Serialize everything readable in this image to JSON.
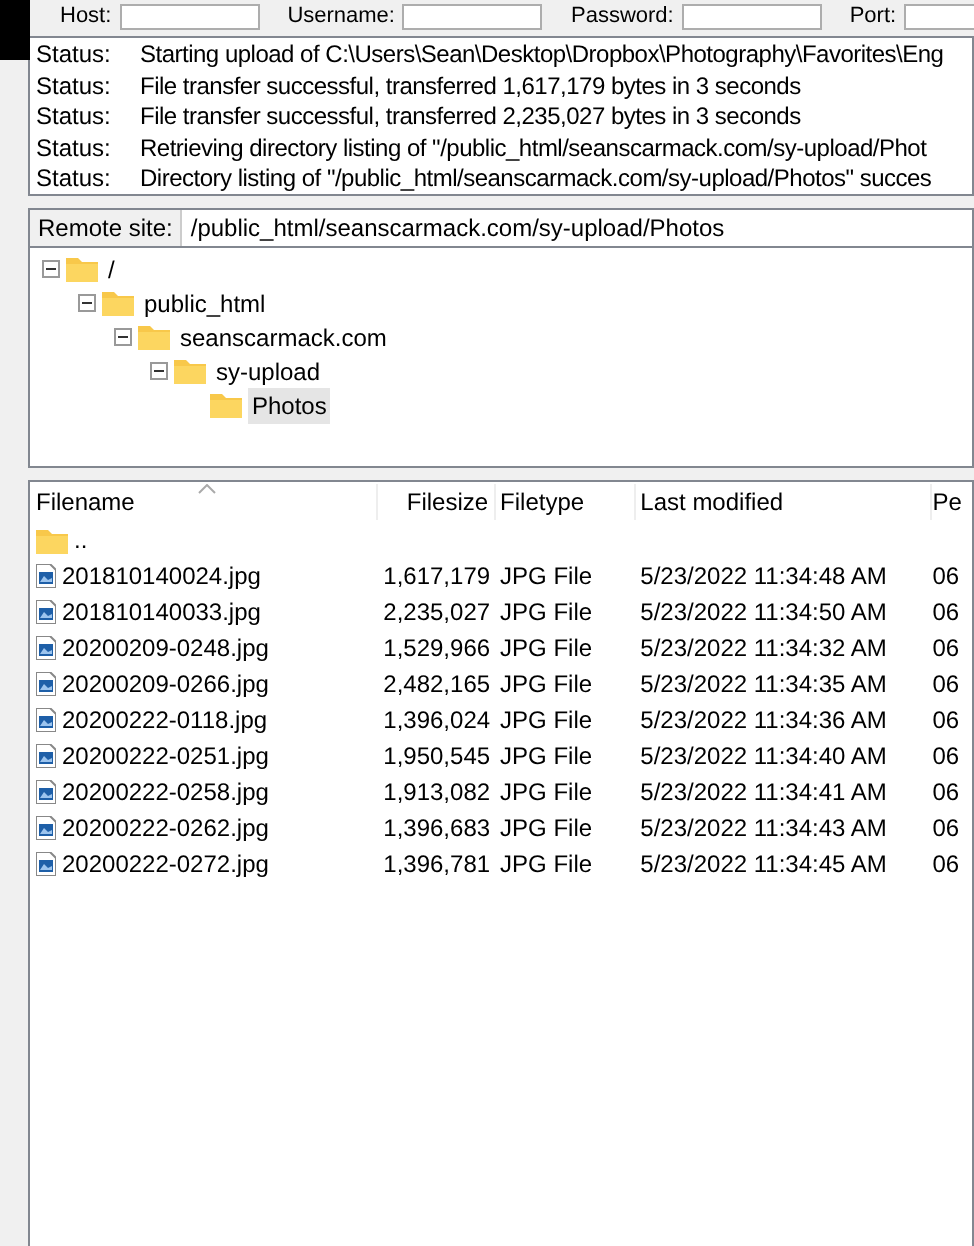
{
  "quickconnect": {
    "fields": [
      {
        "label": "Host:"
      },
      {
        "label": "Username:"
      },
      {
        "label": "Password:"
      },
      {
        "label": "Port:"
      }
    ]
  },
  "message_log": [
    {
      "label": "Status:",
      "message": "Starting upload of C:\\Users\\Sean\\Desktop\\Dropbox\\Photography\\Favorites\\Eng"
    },
    {
      "label": "Status:",
      "message": "File transfer successful, transferred 1,617,179 bytes in 3 seconds"
    },
    {
      "label": "Status:",
      "message": "File transfer successful, transferred 2,235,027 bytes in 3 seconds"
    },
    {
      "label": "Status:",
      "message": "Retrieving directory listing of \"/public_html/seanscarmack.com/sy-upload/Phot"
    },
    {
      "label": "Status:",
      "message": "Directory listing of \"/public_html/seanscarmack.com/sy-upload/Photos\" succes"
    }
  ],
  "remote_site": {
    "label": "Remote site:",
    "value": "/public_html/seanscarmack.com/sy-upload/Photos"
  },
  "tree": [
    {
      "label": "/",
      "expanded": true,
      "selected": false,
      "children": [
        {
          "label": "public_html",
          "expanded": true,
          "selected": false,
          "children": [
            {
              "label": "seanscarmack.com",
              "expanded": true,
              "selected": false,
              "children": [
                {
                  "label": "sy-upload",
                  "expanded": true,
                  "selected": false,
                  "children": [
                    {
                      "label": "Photos",
                      "selected": true
                    }
                  ]
                }
              ]
            }
          ]
        }
      ]
    }
  ],
  "file_list": {
    "columns": [
      "Filename",
      "Filesize",
      "Filetype",
      "Last modified",
      "Pe"
    ],
    "rows": [
      {
        "kind": "parent",
        "name": ".."
      },
      {
        "kind": "file",
        "name": "201810140024.jpg",
        "size": "1,617,179",
        "type": "JPG File",
        "modified": "5/23/2022 11:34:48 AM",
        "column_5": "06"
      },
      {
        "kind": "file",
        "name": "201810140033.jpg",
        "size": "2,235,027",
        "type": "JPG File",
        "modified": "5/23/2022 11:34:50 AM",
        "column_5": "06"
      },
      {
        "kind": "file",
        "name": "20200209-0248.jpg",
        "size": "1,529,966",
        "type": "JPG File",
        "modified": "5/23/2022 11:34:32 AM",
        "column_5": "06"
      },
      {
        "kind": "file",
        "name": "20200209-0266.jpg",
        "size": "2,482,165",
        "type": "JPG File",
        "modified": "5/23/2022 11:34:35 AM",
        "column_5": "06"
      },
      {
        "kind": "file",
        "name": "20200222-0118.jpg",
        "size": "1,396,024",
        "type": "JPG File",
        "modified": "5/23/2022 11:34:36 AM",
        "column_5": "06"
      },
      {
        "kind": "file",
        "name": "20200222-0251.jpg",
        "size": "1,950,545",
        "type": "JPG File",
        "modified": "5/23/2022 11:34:40 AM",
        "column_5": "06"
      },
      {
        "kind": "file",
        "name": "20200222-0258.jpg",
        "size": "1,913,082",
        "type": "JPG File",
        "modified": "5/23/2022 11:34:41 AM",
        "column_5": "06"
      },
      {
        "kind": "file",
        "name": "20200222-0262.jpg",
        "size": "1,396,683",
        "type": "JPG File",
        "modified": "5/23/2022 11:34:43 AM",
        "column_5": "06"
      },
      {
        "kind": "file",
        "name": "20200222-0272.jpg",
        "size": "1,396,781",
        "type": "JPG File",
        "modified": "5/23/2022 11:34:45 AM",
        "column_5": "06"
      }
    ]
  }
}
